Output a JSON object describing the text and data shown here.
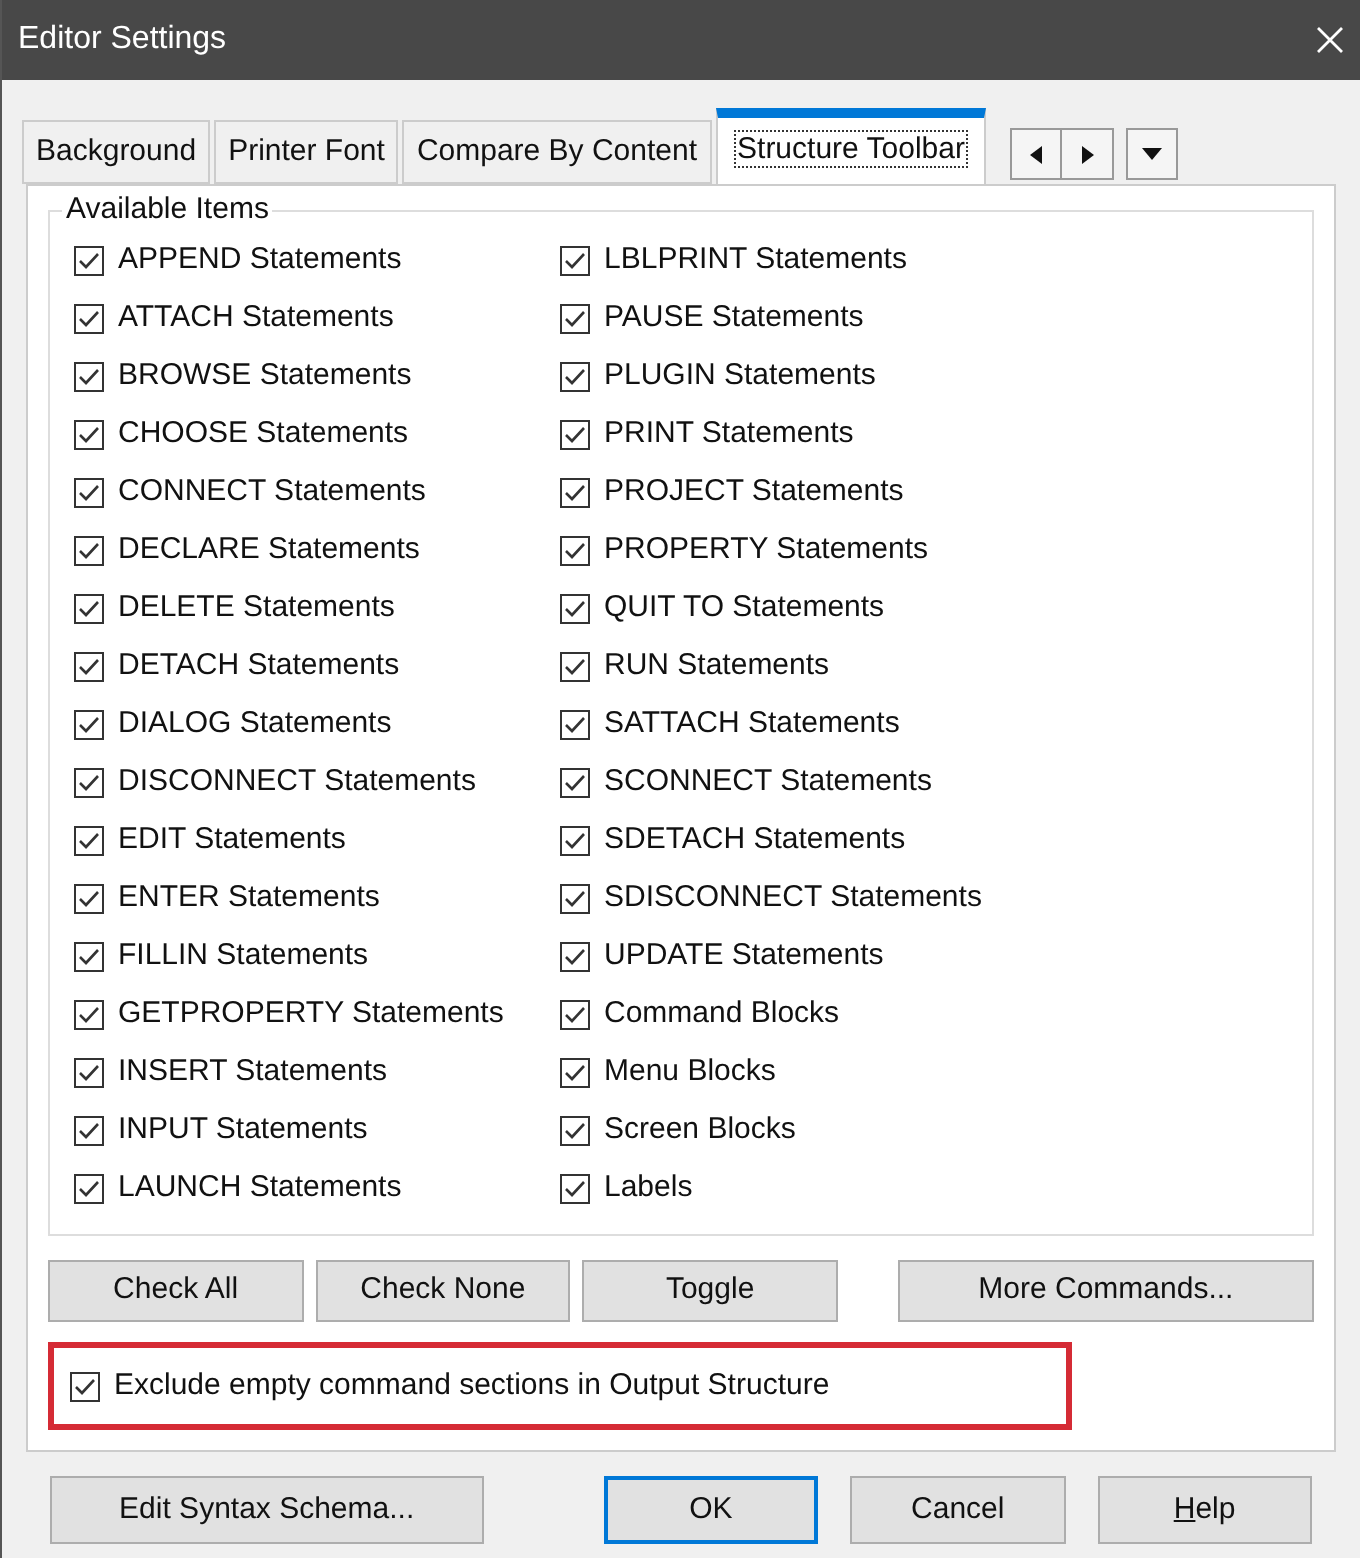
{
  "window": {
    "title": "Editor Settings"
  },
  "tabs": [
    {
      "label": "Background",
      "selected": false
    },
    {
      "label": "Printer Font",
      "selected": false
    },
    {
      "label": "Compare By Content",
      "selected": false
    },
    {
      "label": "Structure Toolbar",
      "selected": true
    }
  ],
  "group": {
    "title": "Available Items",
    "columns": [
      [
        {
          "label": "APPEND Statements",
          "checked": true
        },
        {
          "label": "ATTACH Statements",
          "checked": true
        },
        {
          "label": "BROWSE Statements",
          "checked": true
        },
        {
          "label": "CHOOSE Statements",
          "checked": true
        },
        {
          "label": "CONNECT Statements",
          "checked": true
        },
        {
          "label": "DECLARE Statements",
          "checked": true
        },
        {
          "label": "DELETE Statements",
          "checked": true
        },
        {
          "label": "DETACH Statements",
          "checked": true
        },
        {
          "label": "DIALOG Statements",
          "checked": true
        },
        {
          "label": "DISCONNECT Statements",
          "checked": true
        },
        {
          "label": "EDIT Statements",
          "checked": true
        },
        {
          "label": "ENTER Statements",
          "checked": true
        },
        {
          "label": "FILLIN Statements",
          "checked": true
        },
        {
          "label": "GETPROPERTY Statements",
          "checked": true
        },
        {
          "label": "INSERT Statements",
          "checked": true
        },
        {
          "label": "INPUT Statements",
          "checked": true
        },
        {
          "label": "LAUNCH Statements",
          "checked": true
        }
      ],
      [
        {
          "label": "LBLPRINT Statements",
          "checked": true
        },
        {
          "label": "PAUSE Statements",
          "checked": true
        },
        {
          "label": "PLUGIN Statements",
          "checked": true
        },
        {
          "label": "PRINT Statements",
          "checked": true
        },
        {
          "label": "PROJECT Statements",
          "checked": true
        },
        {
          "label": "PROPERTY Statements",
          "checked": true
        },
        {
          "label": "QUIT TO Statements",
          "checked": true
        },
        {
          "label": "RUN Statements",
          "checked": true
        },
        {
          "label": "SATTACH Statements",
          "checked": true
        },
        {
          "label": "SCONNECT Statements",
          "checked": true
        },
        {
          "label": "SDETACH Statements",
          "checked": true
        },
        {
          "label": "SDISCONNECT Statements",
          "checked": true
        },
        {
          "label": "UPDATE Statements",
          "checked": true
        },
        {
          "label": "Command Blocks",
          "checked": true
        },
        {
          "label": "Menu Blocks",
          "checked": true
        },
        {
          "label": "Screen Blocks",
          "checked": true
        },
        {
          "label": "Labels",
          "checked": true
        }
      ]
    ]
  },
  "action_buttons": [
    "Check All",
    "Check None",
    "Toggle",
    "More Commands..."
  ],
  "exclude_option": {
    "label": "Exclude empty command sections in Output Structure",
    "checked": true
  },
  "footer_buttons": [
    {
      "label": "Edit Syntax Schema...",
      "kind": "plain"
    },
    {
      "label": "OK",
      "kind": "default"
    },
    {
      "label": "Cancel",
      "kind": "plain"
    },
    {
      "label": "Help",
      "kind": "mnemonic"
    }
  ]
}
